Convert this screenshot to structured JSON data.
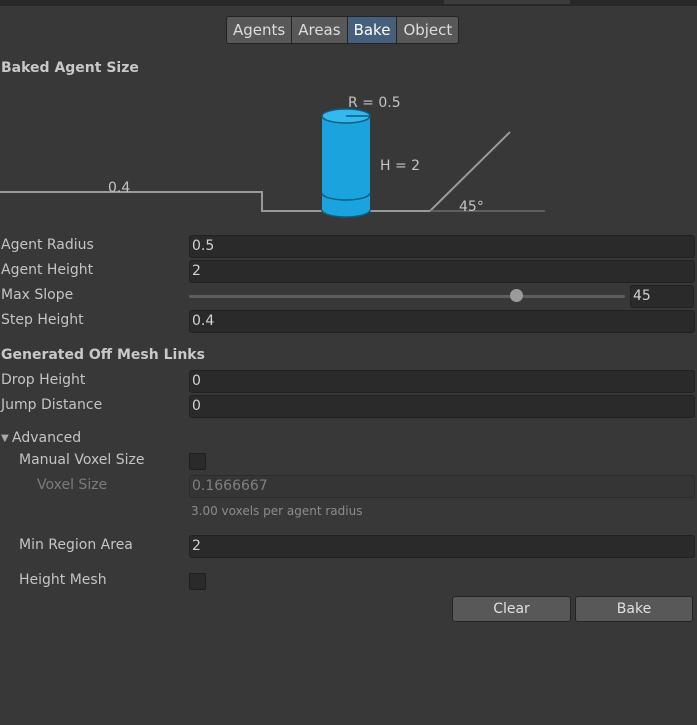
{
  "tabs": [
    "Agents",
    "Areas",
    "Bake",
    "Object"
  ],
  "active_tab": "Bake",
  "baked_agent_size": {
    "title": "Baked Agent Size",
    "radius_label": "R = 0.5",
    "height_label": "H = 2",
    "step_label": "0.4",
    "slope_label": "45°",
    "cylinder_color": "#1aa3dc"
  },
  "fields": {
    "agent_radius": {
      "label": "Agent Radius",
      "value": "0.5"
    },
    "agent_height": {
      "label": "Agent Height",
      "value": "2"
    },
    "max_slope": {
      "label": "Max Slope",
      "value": "45",
      "slider_fraction": 0.75
    },
    "step_height": {
      "label": "Step Height",
      "value": "0.4"
    }
  },
  "off_mesh": {
    "title": "Generated Off Mesh Links",
    "drop_height": {
      "label": "Drop Height",
      "value": "0"
    },
    "jump_distance": {
      "label": "Jump Distance",
      "value": "0"
    }
  },
  "advanced": {
    "title": "Advanced",
    "manual_voxel_size": {
      "label": "Manual Voxel Size",
      "checked": false
    },
    "voxel_size": {
      "label": "Voxel Size",
      "value": "0.1666667"
    },
    "voxel_hint": "3.00 voxels per agent radius",
    "min_region_area": {
      "label": "Min Region Area",
      "value": "2"
    },
    "height_mesh": {
      "label": "Height Mesh",
      "checked": false
    }
  },
  "buttons": {
    "clear": "Clear",
    "bake": "Bake"
  }
}
